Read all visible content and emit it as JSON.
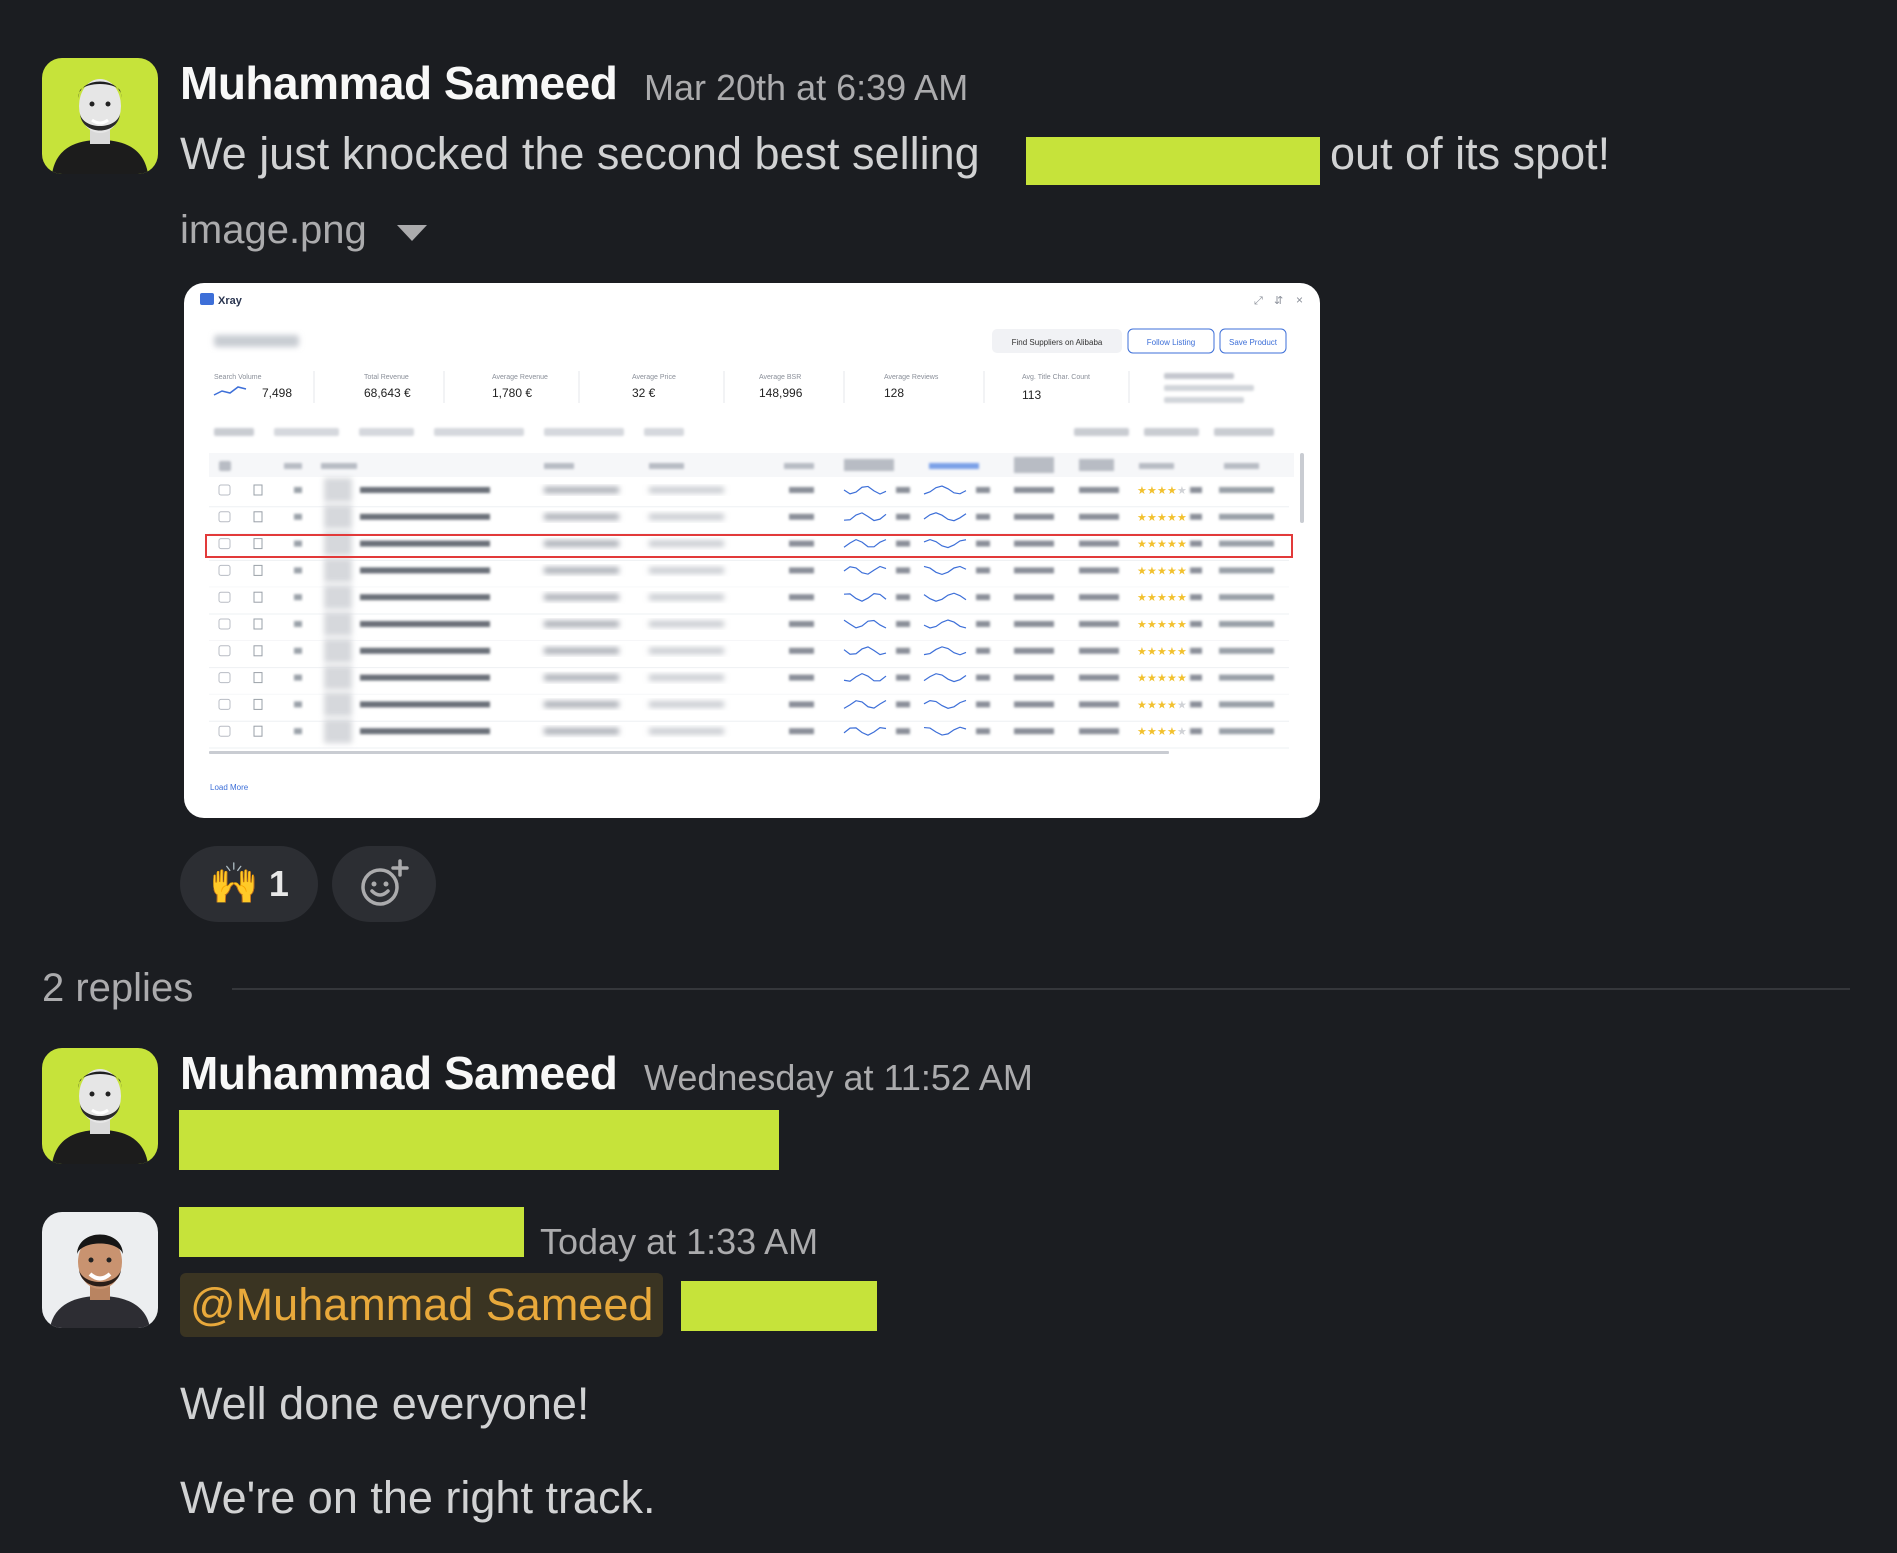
{
  "thread": {
    "parent": {
      "author": "Muhammad Sameed",
      "timestamp": "Mar 20th at 6:39 AM",
      "text_before": "We just knocked the second best selling",
      "text_after": "out of its spot!",
      "attachment": {
        "filename": "image.png",
        "preview_app_name": "Xray",
        "preview_buttons": [
          "Find Suppliers on Alibaba",
          "Follow Listing",
          "Save Product"
        ],
        "preview_stats": [
          {
            "label": "Search Volume",
            "value": "7,498"
          },
          {
            "label": "Total Revenue",
            "value": "68,643 €"
          },
          {
            "label": "Average Revenue",
            "value": "1,780 €"
          },
          {
            "label": "Average Price",
            "value": "32 €"
          },
          {
            "label": "Average BSR",
            "value": "148,996"
          },
          {
            "label": "Average Reviews",
            "value": "128"
          },
          {
            "label": "Avg. Title Char. Count",
            "value": "113"
          }
        ],
        "preview_link": "Load More"
      },
      "reactions": [
        {
          "emoji": "🙌",
          "count": "1"
        }
      ]
    },
    "replies_label": "2 replies",
    "replies": [
      {
        "author": "Muhammad Sameed",
        "timestamp": "Wednesday at 11:52 AM"
      },
      {
        "author": "",
        "timestamp": "Today at 1:33 AM",
        "mention": "@Muhammad Sameed",
        "lines": [
          "Well done everyone!",
          "We're on the right track."
        ]
      }
    ]
  },
  "colors": {
    "background": "#1b1d21",
    "redaction": "#c6e33a",
    "mention_text": "#e8a93b",
    "mention_bg": "#3a3422",
    "highlight_row": "#e23a3a"
  },
  "icons": {
    "caret": "chevron-down-icon",
    "add_reaction": "add-reaction-icon"
  }
}
